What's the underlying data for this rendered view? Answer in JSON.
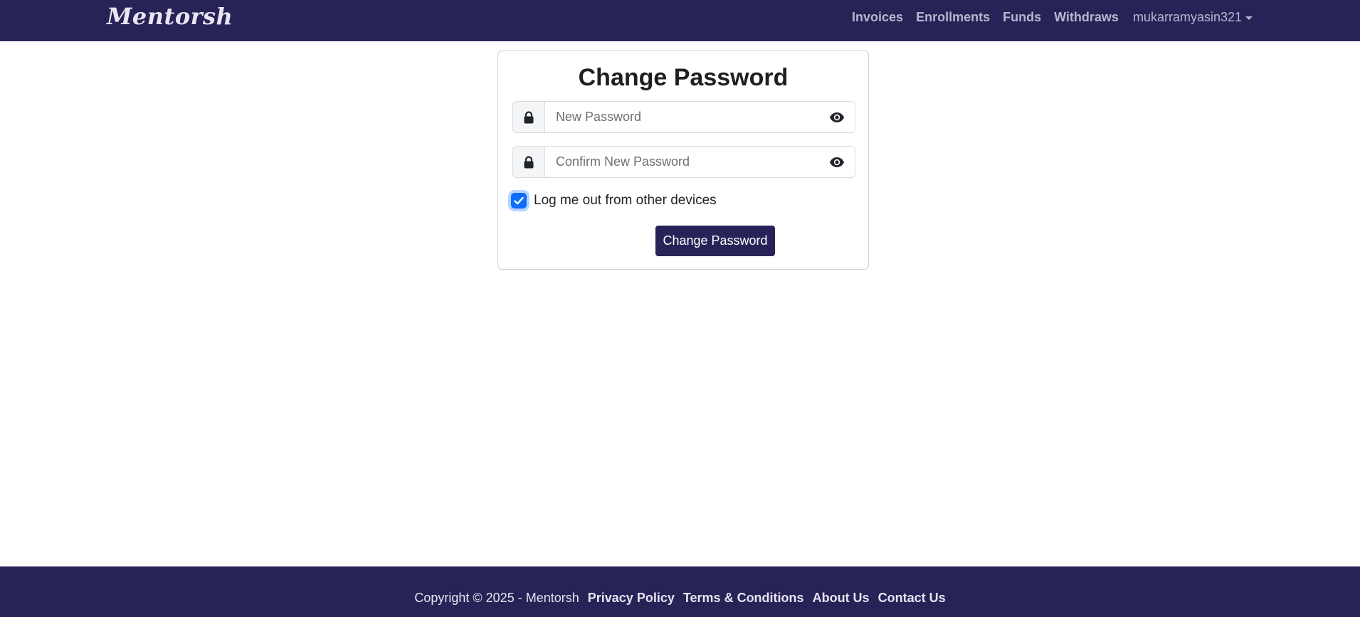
{
  "navbar": {
    "brand": "Mentorsh",
    "links": [
      "Invoices",
      "Enrollments",
      "Funds",
      "Withdraws"
    ],
    "user": "mukarramyasin321"
  },
  "form": {
    "title": "Change Password",
    "new_password_placeholder": "New Password",
    "confirm_password_placeholder": "Confirm New Password",
    "logout_label": "Log me out from other devices",
    "logout_checked": true,
    "submit_label": "Change Password"
  },
  "footer": {
    "copyright": "Copyright © 2025 - Mentorsh",
    "links": [
      "Privacy Policy",
      "Terms & Conditions",
      "About Us",
      "Contact Us"
    ]
  },
  "colors": {
    "brand_bg": "#282357",
    "checkbox": "#0d6efd"
  },
  "icons": {
    "field_icon": "lock-icon",
    "toggle_icon": "eye-icon",
    "check_icon": "checkmark-icon",
    "user_menu_icon": "caret-down-icon"
  }
}
